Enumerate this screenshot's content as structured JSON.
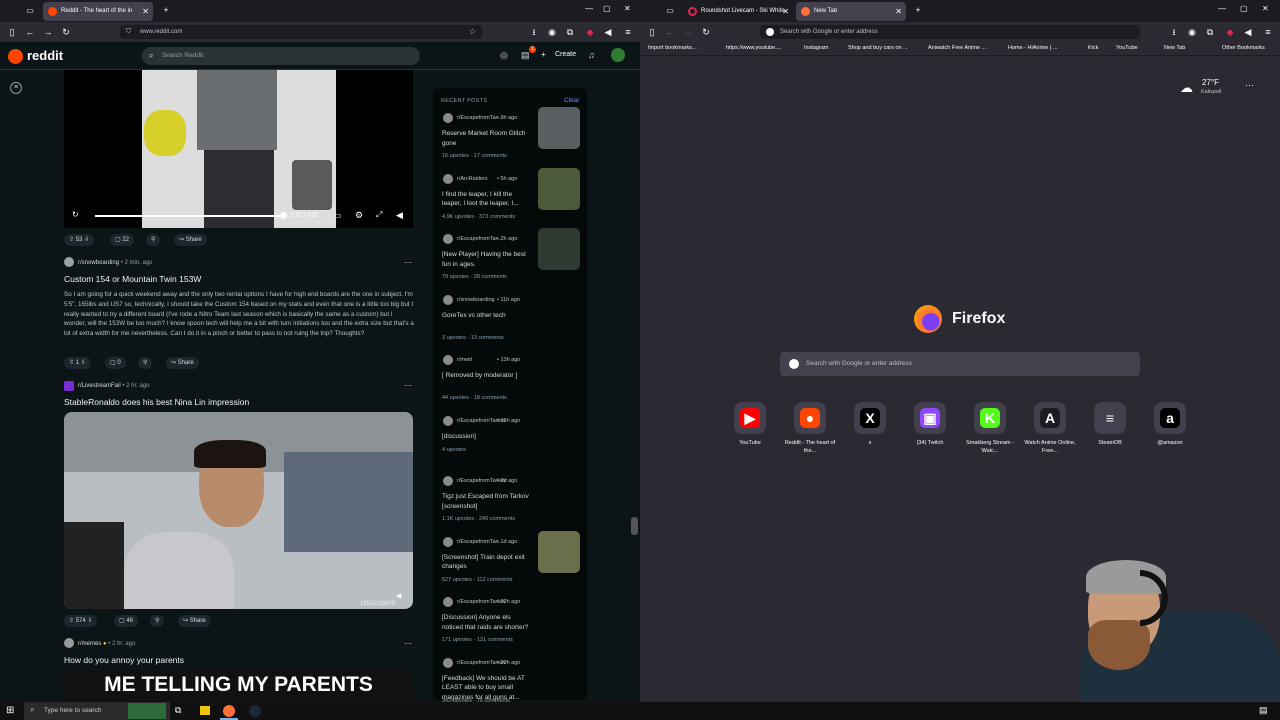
{
  "left_window": {
    "tabs": [
      {
        "label": "Reddit - The heart of the in"
      }
    ],
    "url": "www.reddit.com"
  },
  "reddit": {
    "logo": "reddit",
    "search_placeholder": "Search Reddit",
    "create_label": "Create",
    "notification_count": "1",
    "video_time": "0:37 / 0:37",
    "post1_actions": {
      "votes": "53",
      "comments": "22",
      "share": "Share"
    },
    "post2": {
      "subreddit": "r/snowboarding",
      "time": "• 2 min. ago",
      "title": "Custom 154 or Mountain Twin 153W",
      "body": "So I am going for a quick weekend away and the only two rental options I have for high end boards are the one in subject. I'm 5'5\", 165lbs and US7 so, technically, I should take the Custom 154 based on my stats and even that one is a little too big but I really wanted to try a different board (I've rode a Nitro Team last season which is basically the same as a custom) but I wonder, will the 153W be too much? I know spoon tech will help me a bit with turn initiations too and the extra size but that's a lot of extra width for me nevertheless. Can I do it in a pinch or better to pass to not ruing the trip? Thoughts?",
      "votes": "1",
      "comments": "0",
      "share": "Share"
    },
    "post3": {
      "subreddit": "r/LivestreamFail",
      "time": "• 2 hr. ago",
      "title": "StableRonaldo does his best Nina Lin impression",
      "video_counter": "16522/16609",
      "votes": "574",
      "comments": "46",
      "share": "Share"
    },
    "post4": {
      "subreddit": "r/memes",
      "time": "• 2 hr. ago",
      "title": "How do you annoy your parents",
      "meme_text": "ME TELLING MY PARENTS"
    },
    "recent": {
      "heading": "RECENT POSTS",
      "clear": "Clear",
      "items": [
        {
          "sub": "r/EscapefromTar...",
          "time": "• 9h ago",
          "title": "Reserve Market Room Glitch gone",
          "meta": "16 upvotes  ·  17 comments"
        },
        {
          "sub": "r/ArcRaiders",
          "time": "• 5h ago",
          "title": "I find the leaper, I kill the leaper, I loot the leaper, I...",
          "meta": "4.9K upvotes  ·  373 comments"
        },
        {
          "sub": "r/EscapefromTar...",
          "time": "• 2h ago",
          "title": "[New Player] Having the best fun in ages.",
          "meta": "79 upvotes  ·  28 comments"
        },
        {
          "sub": "r/snowboarding",
          "time": "• 11h ago",
          "title": "GoreTex vs other tech",
          "meta": "3 upvotes  ·  13 comments"
        },
        {
          "sub": "r/meirl",
          "time": "• 13h ago",
          "title": "[ Removed by moderator ]",
          "meta": "44 upvotes  ·  18 comments"
        },
        {
          "sub": "r/EscapefromTarkov",
          "time": "• 15h ago",
          "title": "[discussion]",
          "meta": "4 upvotes"
        },
        {
          "sub": "r/EscapefromTarkov",
          "time": "• 2d ago",
          "title": "Tigz just Escaped from Tarkov [screenshot]",
          "meta": "1.1K upvotes  ·  240 comments"
        },
        {
          "sub": "r/EscapefromTar...",
          "time": "• 1d ago",
          "title": "[Screenshot] Train depot exit changes",
          "meta": "527 upvotes  ·  112 comments"
        },
        {
          "sub": "r/EscapefromTarkov",
          "time": "• 22h ago",
          "title": "[Discussion] Anyone els noticed that raids are shorter?",
          "meta": "171 upvotes  ·  131 comments"
        },
        {
          "sub": "r/EscapefromTarkov",
          "time": "• 20h ago",
          "title": "[Feedback] We should be AT LEAST able to buy small magazines for all guns at...",
          "meta": "342 upvotes  ·  78 comments"
        }
      ]
    }
  },
  "right_window": {
    "tabs": [
      {
        "label": "Roundshot Livecam - Ski White"
      },
      {
        "label": "New Tab"
      }
    ],
    "url_placeholder": "Search with Google or enter address",
    "bookmarks": [
      "Import bookmarks...",
      "https://www.youtube....",
      "Instagram",
      "Shop and buy cars on ...",
      "Aniwatch Free Anime ...",
      "Home - HiAnime | ...",
      "Kick",
      "YouTube",
      "New Tab",
      "Other Bookmarks"
    ],
    "weather_temp": "27°F",
    "weather_city": "Kalispell",
    "brand": "Firefox",
    "search_placeholder": "Search with Google or enter address",
    "shortcuts": [
      {
        "label": "YouTube",
        "icon": "youtube-icon",
        "glyph": "▶",
        "color": "#ff0000"
      },
      {
        "label": "Reddit - The heart of the...",
        "icon": "reddit-icon",
        "glyph": "●",
        "color": "#ff4500"
      },
      {
        "label": "x",
        "icon": "x-icon",
        "glyph": "X",
        "color": "#000000"
      },
      {
        "label": "(34) Twitch",
        "icon": "twitch-icon",
        "glyph": "▣",
        "color": "#9146ff"
      },
      {
        "label": "Smakberg Stream - Watc...",
        "icon": "kick-icon",
        "glyph": "K",
        "color": "#53fc18"
      },
      {
        "label": "Watch Anime Online, Free...",
        "icon": "anime-icon",
        "glyph": "A",
        "color": "#1c1b22"
      },
      {
        "label": "SteamDB",
        "icon": "steamdb-icon",
        "glyph": "≡",
        "color": "#42414d"
      },
      {
        "label": "@amazon",
        "icon": "amazon-icon",
        "glyph": "a",
        "color": "#000000"
      }
    ]
  },
  "taskbar": {
    "search_placeholder": "Type here to search"
  }
}
